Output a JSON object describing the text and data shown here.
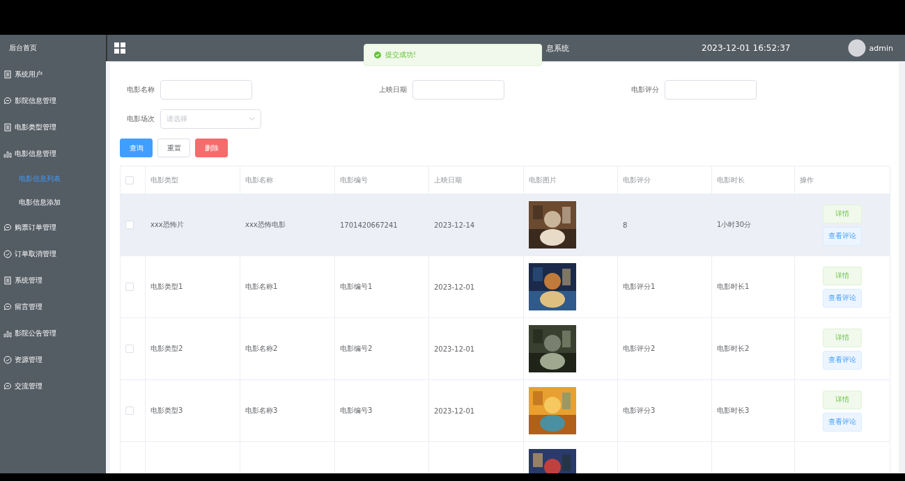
{
  "sidebar": {
    "items": [
      {
        "label": "后台首页",
        "kind": "home"
      },
      {
        "label": "系统用户",
        "kind": "doc"
      },
      {
        "label": "影院信息管理",
        "kind": "chat"
      },
      {
        "label": "电影类型管理",
        "kind": "doc"
      },
      {
        "label": "电影信息管理",
        "kind": "bars",
        "children": [
          {
            "label": "电影信息列表",
            "selected": true
          },
          {
            "label": "电影信息添加",
            "selected": false
          }
        ]
      },
      {
        "label": "购票订单管理",
        "kind": "chat"
      },
      {
        "label": "订单取消管理",
        "kind": "check"
      },
      {
        "label": "系统管理",
        "kind": "doc"
      },
      {
        "label": "留言管理",
        "kind": "chat"
      },
      {
        "label": "影院公告管理",
        "kind": "bars"
      },
      {
        "label": "资源管理",
        "kind": "check"
      },
      {
        "label": "交流管理",
        "kind": "chat"
      }
    ]
  },
  "header": {
    "title": "息系统",
    "datetime": "2023-12-01 16:52:37",
    "user": "admin"
  },
  "toast": {
    "message": "提交成功!"
  },
  "filters": [
    {
      "label": "电影名称",
      "kind": "input"
    },
    {
      "label": "上映日期",
      "kind": "input"
    },
    {
      "label": "电影评分",
      "kind": "input"
    },
    {
      "label": "电影场次",
      "kind": "select",
      "placeholder": "请选择"
    }
  ],
  "actions": [
    {
      "label": "查询",
      "kind": "primary"
    },
    {
      "label": "重置",
      "kind": "default"
    },
    {
      "label": "删除",
      "kind": "danger"
    }
  ],
  "table": {
    "header_checked": false,
    "columns": [
      "电影类型",
      "电影名称",
      "电影编号",
      "上映日期",
      "电影图片",
      "电影评分",
      "电影时长",
      "操作"
    ],
    "rows": [
      {
        "selected": true,
        "checked": false,
        "cells": [
          "xxx恐怖片",
          "xxx恐怖电影",
          "1701420667241",
          "2023-12-14"
        ],
        "rating": "8",
        "duration": "1小时30分",
        "buttons": [
          "详情",
          "查看评论"
        ]
      },
      {
        "selected": false,
        "checked": false,
        "cells": [
          "电影类型1",
          "电影名称1",
          "电影编号1",
          "2023-12-01"
        ],
        "rating": "电影评分1",
        "duration": "电影时长1",
        "buttons": [
          "详情",
          "查看评论"
        ]
      },
      {
        "selected": false,
        "checked": false,
        "cells": [
          "电影类型2",
          "电影名称2",
          "电影编号2",
          "2023-12-01"
        ],
        "rating": "电影评分2",
        "duration": "电影时长2",
        "buttons": [
          "详情",
          "查看评论"
        ]
      },
      {
        "selected": false,
        "checked": false,
        "cells": [
          "电影类型3",
          "电影名称3",
          "电影编号3",
          "2023-12-01"
        ],
        "rating": "电影评分3",
        "duration": "电影时长3",
        "buttons": [
          "详情",
          "查看评论"
        ]
      },
      {
        "selected": false,
        "cells": [],
        "buttons": []
      }
    ]
  }
}
